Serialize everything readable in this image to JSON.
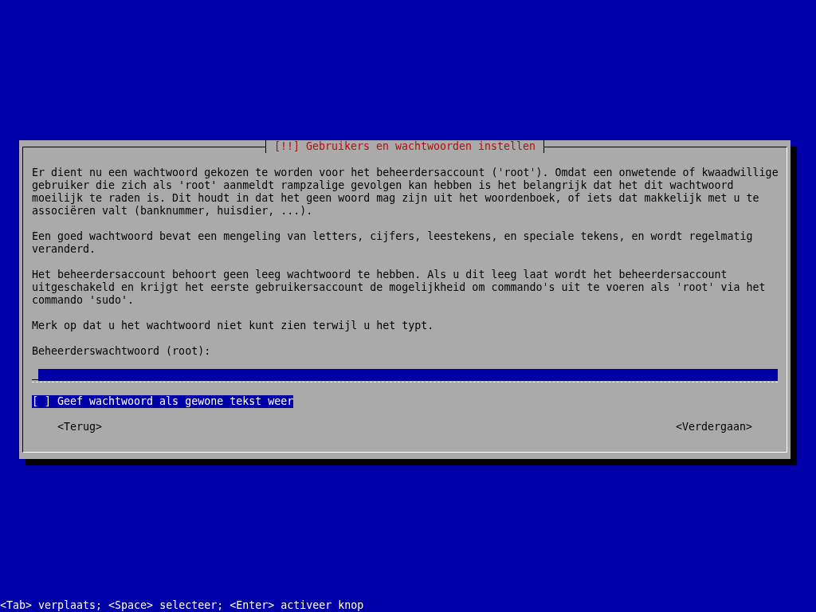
{
  "dialog": {
    "title": "[!!] Gebruikers en wachtwoorden instellen",
    "paragraphs": [
      "Er dient nu een wachtwoord gekozen te worden voor het beheerdersaccount ('root'). Omdat een onwetende of kwaadwillige\ngebruiker die zich als 'root' aanmeldt rampzalige gevolgen kan hebben is het belangrijk dat het dit wachtwoord\nmoeilijk te raden is. Dit houdt in dat het geen woord mag zijn uit het woordenboek, of iets dat makkelijk met u te\nassociëren valt (banknummer, huisdier, ...).",
      "Een goed wachtwoord bevat een mengeling van letters, cijfers, leestekens, en speciale tekens, en wordt regelmatig\nveranderd.",
      "Het beheerdersaccount behoort geen leeg wachtwoord te hebben. Als u dit leeg laat wordt het beheerdersaccount\nuitgeschakeld en krijgt het eerste gebruikersaccount de mogelijkheid om commando's uit te voeren als 'root' via het\ncommando 'sudo'.",
      "Merk op dat u het wachtwoord niet kunt zien terwijl u het typt."
    ],
    "field_label": "Beheerderswachtwoord (root):",
    "checkbox": {
      "box": "[ ]",
      "label": "Geef wachtwoord als gewone tekst weer",
      "checked": false,
      "selected": true
    },
    "buttons": [
      {
        "label": "<Terug>",
        "selected": false
      },
      {
        "label": "<Verdergaan>",
        "selected": false
      }
    ]
  },
  "status_bar": "<Tab> verplaats; <Space> selecteer; <Enter> activeer knop"
}
